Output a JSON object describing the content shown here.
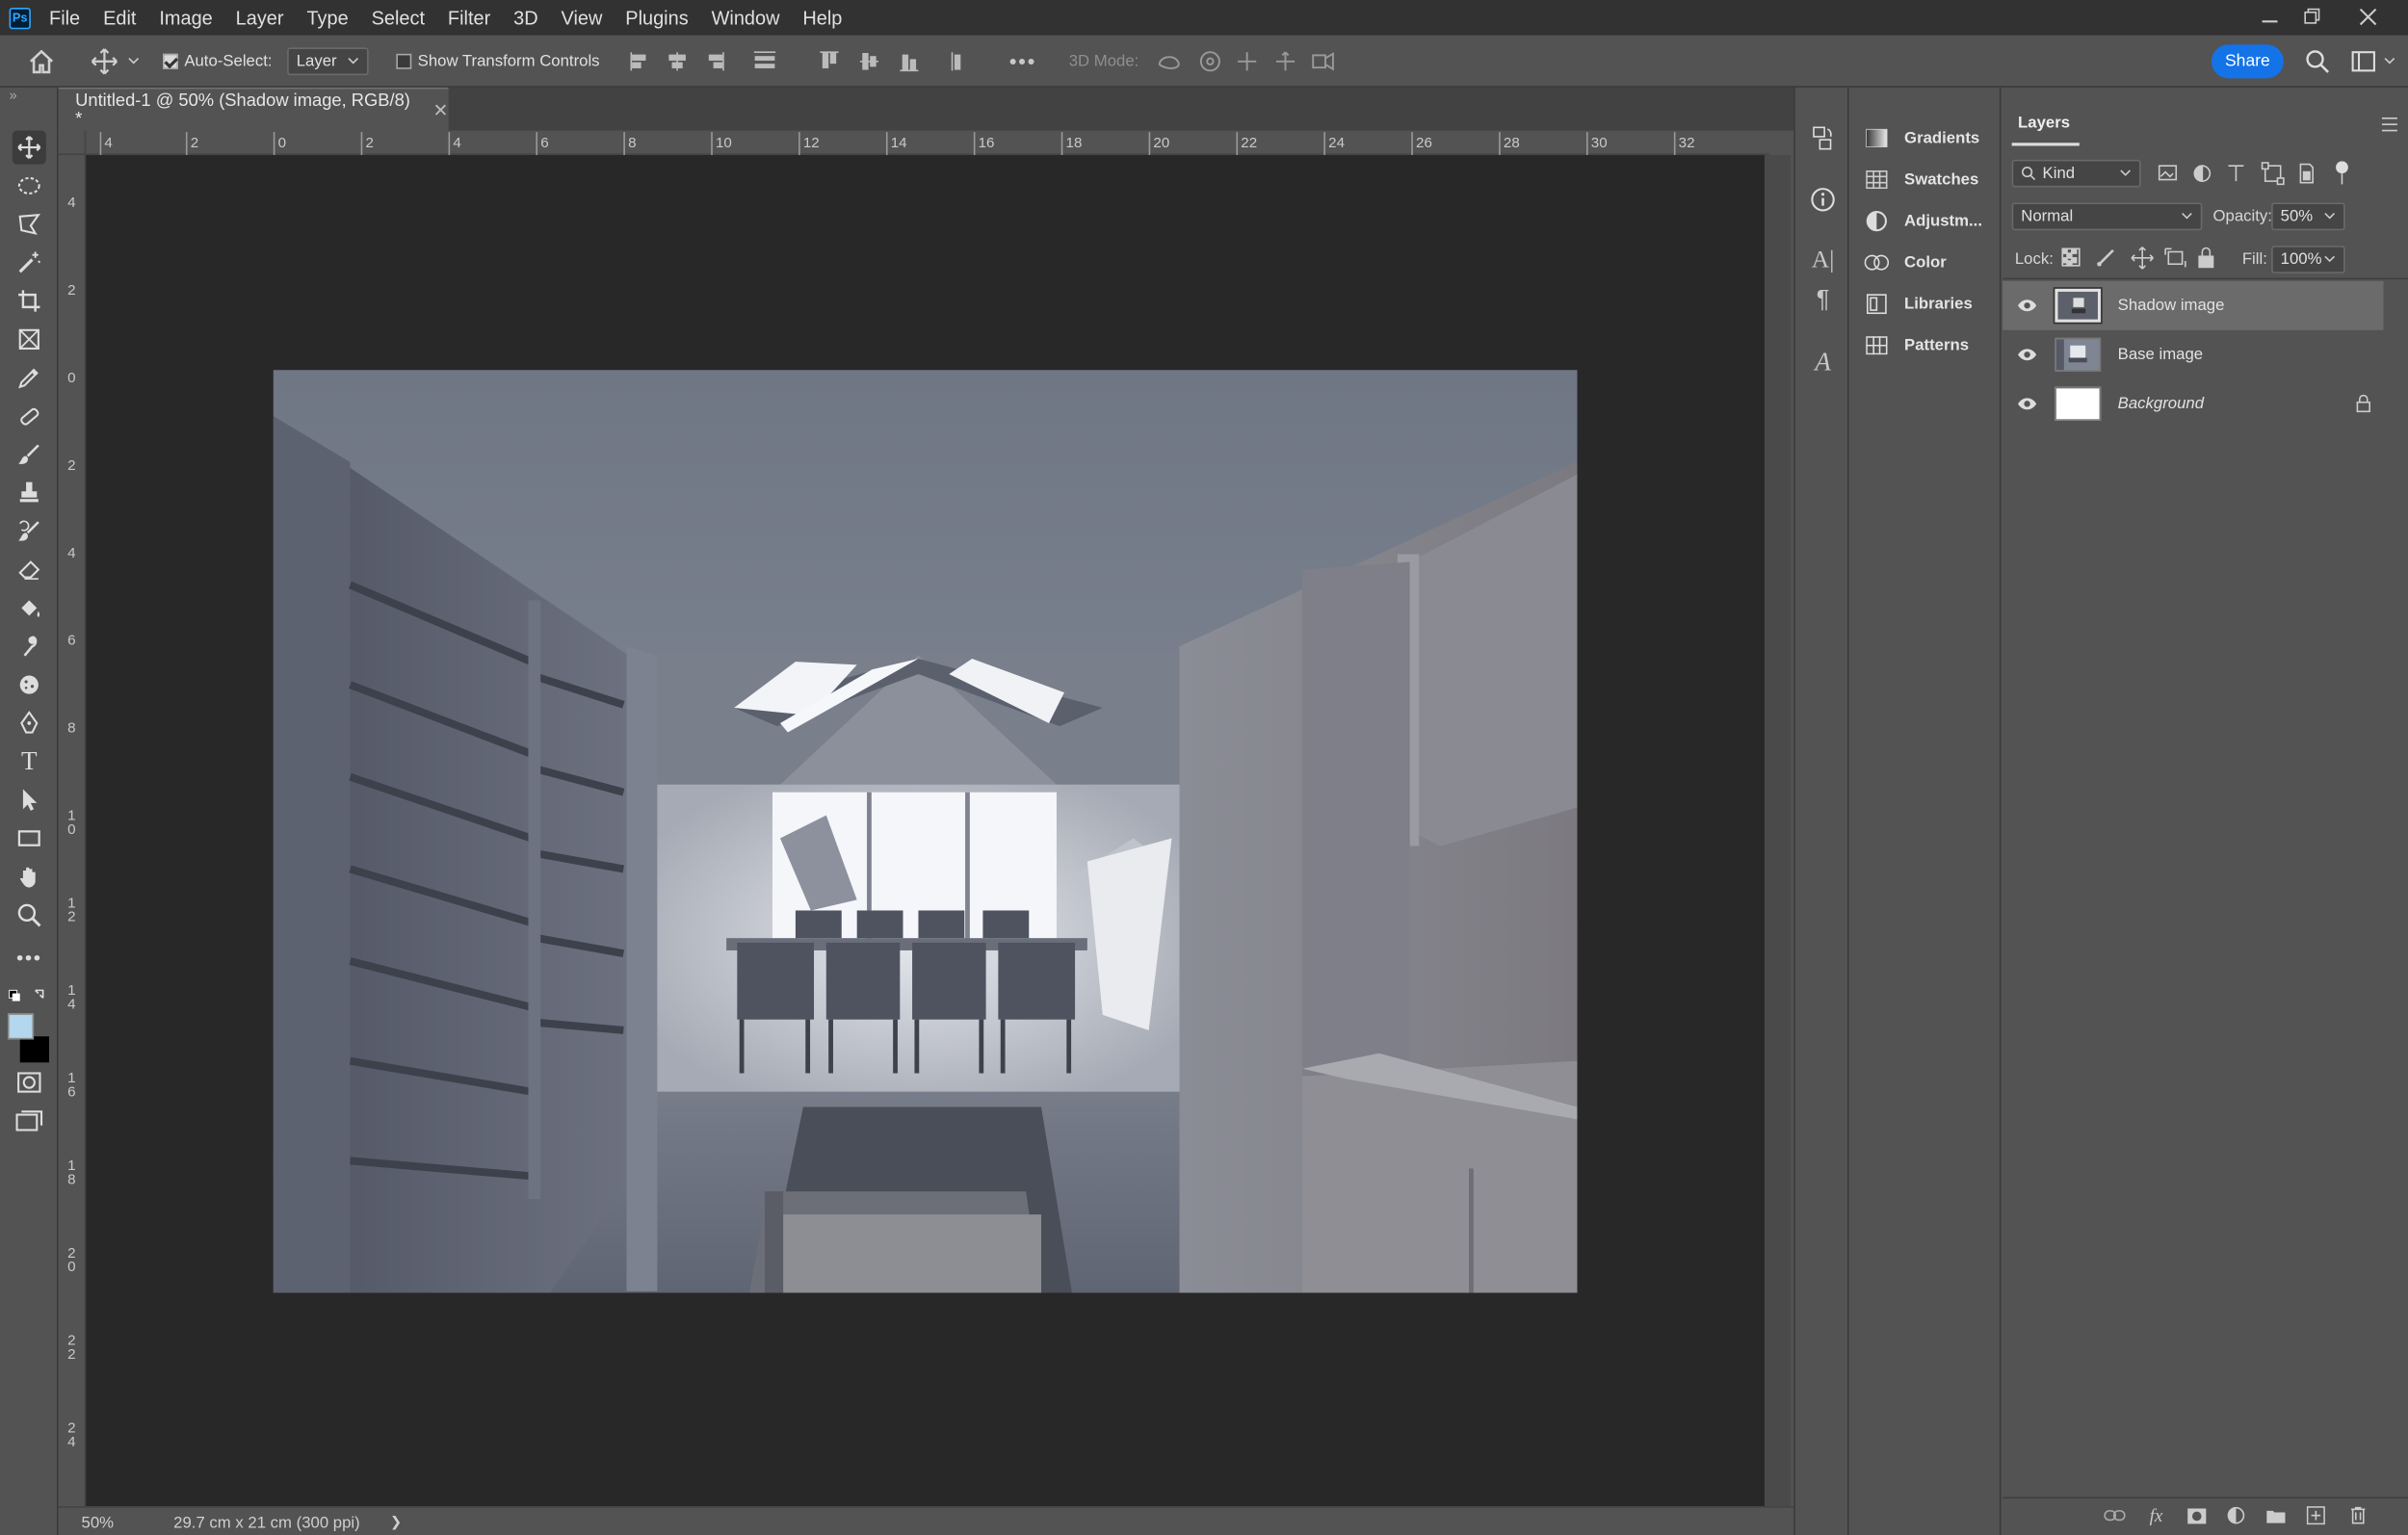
{
  "app": {
    "logo": "Ps"
  },
  "menu": [
    "File",
    "Edit",
    "Image",
    "Layer",
    "Type",
    "Select",
    "Filter",
    "3D",
    "View",
    "Plugins",
    "Window",
    "Help"
  ],
  "options": {
    "auto_select_label": "Auto-Select:",
    "auto_select_checked": true,
    "auto_select_value": "Layer",
    "transform_label": "Show Transform Controls",
    "transform_checked": false,
    "mode_label": "3D Mode:",
    "share_label": "Share"
  },
  "document": {
    "tab_title": "Untitled-1 @ 50% (Shadow image, RGB/8) *"
  },
  "ruler_h": [
    "4",
    "2",
    "0",
    "2",
    "4",
    "6",
    "8",
    "10",
    "12",
    "14",
    "16",
    "18",
    "20",
    "22",
    "24",
    "26",
    "28",
    "30",
    "32"
  ],
  "ruler_v": [
    "4",
    "2",
    "0",
    "2",
    "4",
    "6",
    "8",
    "1\n0",
    "1\n2",
    "1\n4",
    "1\n6",
    "1\n8",
    "2\n0",
    "2\n2",
    "2\n4"
  ],
  "status": {
    "zoom": "50%",
    "doc_size": "29.7 cm x 21 cm (300 ppi)",
    "arrow": "❯"
  },
  "colors": {
    "foreground": "#b3d7ec",
    "background": "#000000",
    "accent": "#1473e6"
  },
  "side_panels": [
    "Gradients",
    "Swatches",
    "Adjustm...",
    "Color",
    "Libraries",
    "Patterns"
  ],
  "layers_panel": {
    "title": "Layers",
    "filter_label": "Kind",
    "blend_mode": "Normal",
    "opacity_label": "Opacity:",
    "opacity_value": "50%",
    "lock_label": "Lock:",
    "fill_label": "Fill:",
    "fill_value": "100%",
    "layers": [
      {
        "name": "Shadow image",
        "selected": true
      },
      {
        "name": "Base image",
        "selected": false
      },
      {
        "name": "Background",
        "selected": false,
        "locked": true
      }
    ]
  }
}
